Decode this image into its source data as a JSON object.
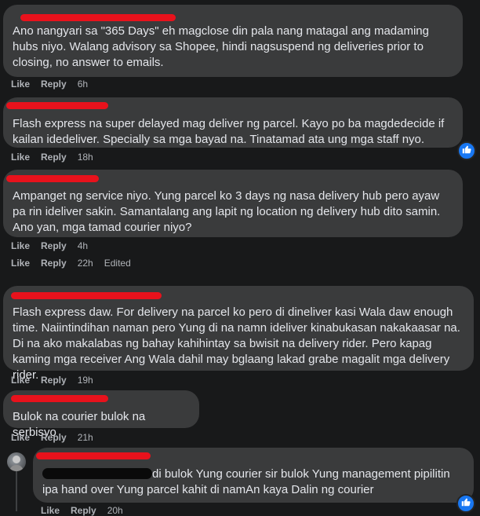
{
  "comments": [
    {
      "text": "Ano nangyari sa \"365 Days\" eh magclose din pala nang matagal ang madaming hubs niyo. Walang advisory sa Shopee, hindi nagsuspend ng deliveries prior to closing, no answer to emails.",
      "like": "Like",
      "reply": "Reply",
      "time": "6h"
    },
    {
      "text": "Flash express na super delayed mag deliver ng parcel. Kayo po ba magdedecide if kailan idedeliver. Specially sa mga bayad na. Tinatamad ata ung mga staff nyo.",
      "like": "Like",
      "reply": "Reply",
      "time": "18h",
      "reaction_icon": "thumbs-up-icon"
    },
    {
      "text": "Ampanget ng service niyo. Yung parcel ko 3 days ng nasa delivery hub pero ayaw pa rin ideliver sakin. Samantalang ang lapit ng location ng delivery hub dito samin. Ano yan, mga tamad courier niyo?",
      "like": "Like",
      "reply": "Reply",
      "time": "4h",
      "extra_actions": {
        "like": "Like",
        "reply": "Reply",
        "time": "22h",
        "edited": "Edited"
      }
    },
    {
      "text": "Flash express daw. For delivery na parcel ko pero di dineliver kasi Wala daw enough time. Naiintindihan naman pero Yung di na namn ideliver kinabukasan nakakaasar na. Di na ako makalabas ng bahay kahihintay sa bwisit na delivery rider. Pero kapag kaming mga receiver Ang Wala dahil may bglaang lakad grabe magalit mga delivery rider.",
      "like": "Like",
      "reply": "Reply",
      "time": "19h"
    },
    {
      "text": "Bulok na courier bulok na serbisyo",
      "like": "Like",
      "reply": "Reply",
      "time": "21h"
    }
  ],
  "reply": {
    "text": "di bulok Yung courier sir bulok Yung management pipilitin ipa hand over Yung parcel kahit di namAn kaya Dalin ng courier",
    "like": "Like",
    "reply": "Reply",
    "time": "20h",
    "reaction_icon": "thumbs-up-icon"
  },
  "colors": {
    "background": "#18191a",
    "bubble": "#3a3b3c",
    "text": "#e4e6eb",
    "meta": "#b0b3b8",
    "redaction": "#e8121c",
    "reaction": "#1877f2"
  }
}
